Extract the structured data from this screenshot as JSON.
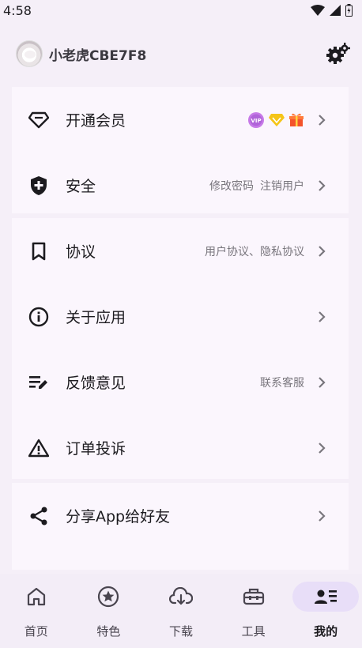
{
  "status": {
    "time": "4:58"
  },
  "header": {
    "username": "小老虎CBE7F8"
  },
  "menu": {
    "vip": {
      "label": "开通会员"
    },
    "security": {
      "label": "安全",
      "sub1": "修改密码",
      "sub2": "注销用户"
    },
    "agreement": {
      "label": "协议",
      "sub": "用户协议、隐私协议"
    },
    "about": {
      "label": "关于应用"
    },
    "feedback": {
      "label": "反馈意见",
      "sub": "联系客服"
    },
    "complaint": {
      "label": "订单投诉"
    },
    "share": {
      "label": "分享App给好友"
    }
  },
  "nav": [
    {
      "label": "首页",
      "icon": "home-icon"
    },
    {
      "label": "特色",
      "icon": "star-circle-icon"
    },
    {
      "label": "下载",
      "icon": "cloud-download-icon"
    },
    {
      "label": "工具",
      "icon": "toolbox-icon"
    },
    {
      "label": "我的",
      "icon": "person-list-icon",
      "active": true
    }
  ],
  "colors": {
    "accent_pill": "#e8def8",
    "card_bg": "#fbf6fd",
    "page_bg": "#f5eff8"
  }
}
